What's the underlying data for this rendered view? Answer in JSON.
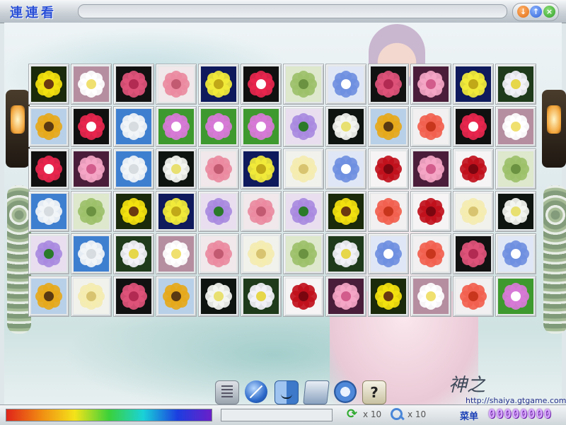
{
  "window": {
    "title": "連連看",
    "buttons": {
      "minimize": "↓",
      "maximize": "↑",
      "close": "×"
    }
  },
  "background": {
    "logo": "神之",
    "url": "http://shaiya.gtgame.com.cn"
  },
  "board": {
    "rows": 6,
    "cols": 12,
    "flower_types": {
      "yellow-daisy": {
        "bg": "#1a2a0a",
        "petal": "#f4e20f",
        "center": "#6b3a10"
      },
      "white-lily": {
        "bg": "#b58ea0",
        "petal": "#ffffff",
        "center": "#f0e070"
      },
      "pink-rose": {
        "bg": "#111111",
        "petal": "#e0537a",
        "center": "#b22a52"
      },
      "pink-gerbera": {
        "bg": "#f0e8ea",
        "petal": "#ea8aa0",
        "center": "#c25a72"
      },
      "yellow-aster": {
        "bg": "#0e1a5c",
        "petal": "#f3ec3a",
        "center": "#c0a818"
      },
      "red-carnation": {
        "bg": "#101010",
        "petal": "#e8264e",
        "center": "#ffffff"
      },
      "green-hydrangea": {
        "bg": "#dde8cc",
        "petal": "#9cc06a",
        "center": "#6a9240"
      },
      "blue-star": {
        "bg": "#dfe7f6",
        "petal": "#6f8fe0",
        "center": "#ffffff"
      },
      "pink-blossom": {
        "bg": "#4a1e3a",
        "petal": "#f5a6c6",
        "center": "#d25c8c"
      },
      "sunflower": {
        "bg": "#b8d0e8",
        "petal": "#e6a81a",
        "center": "#5a3a12"
      },
      "white-rose": {
        "bg": "#3e7fd0",
        "petal": "#f3f5f6",
        "center": "#d6dce0"
      },
      "pink-orchid": {
        "bg": "#3e9a2e",
        "petal": "#d87ad8",
        "center": "#ffffff"
      },
      "purple-iris": {
        "bg": "#e8def0",
        "petal": "#a88ae0",
        "center": "#2a7a2a"
      },
      "calla-lily": {
        "bg": "#0e1410",
        "petal": "#f4f6f2",
        "center": "#e8e070"
      },
      "coral-gerbera": {
        "bg": "#f2f0f0",
        "petal": "#f2604e",
        "center": "#c8361e"
      },
      "red-rose": {
        "bg": "#f6f4f4",
        "petal": "#c0101c",
        "center": "#7a0610"
      },
      "yellow-rose": {
        "bg": "#f2f2ec",
        "petal": "#f4ecb0",
        "center": "#d8c470"
      },
      "white-asters": {
        "bg": "#1e3a1a",
        "petal": "#f2f2f8",
        "center": "#e6d64a"
      }
    },
    "tiles": [
      [
        "yellow-daisy",
        "white-lily",
        "pink-rose",
        "pink-gerbera",
        "yellow-aster",
        "red-carnation",
        "green-hydrangea",
        "blue-star",
        "pink-rose",
        "pink-blossom",
        "yellow-aster",
        "white-asters"
      ],
      [
        "sunflower",
        "red-carnation",
        "white-rose",
        "pink-orchid",
        "pink-orchid",
        "pink-orchid",
        "purple-iris",
        "calla-lily",
        "sunflower",
        "coral-gerbera",
        "red-carnation",
        "white-lily"
      ],
      [
        "red-carnation",
        "pink-blossom",
        "white-rose",
        "calla-lily",
        "pink-gerbera",
        "yellow-aster",
        "yellow-rose",
        "blue-star",
        "red-rose",
        "pink-blossom",
        "red-rose",
        "green-hydrangea"
      ],
      [
        "white-rose",
        "green-hydrangea",
        "yellow-daisy",
        "yellow-aster",
        "purple-iris",
        "pink-gerbera",
        "purple-iris",
        "yellow-daisy",
        "coral-gerbera",
        "red-rose",
        "yellow-rose",
        "calla-lily"
      ],
      [
        "purple-iris",
        "white-rose",
        "white-asters",
        "white-lily",
        "pink-gerbera",
        "yellow-rose",
        "green-hydrangea",
        "white-asters",
        "blue-star",
        "coral-gerbera",
        "pink-rose",
        "blue-star"
      ],
      [
        "sunflower",
        "yellow-rose",
        "pink-rose",
        "sunflower",
        "calla-lily",
        "white-asters",
        "red-rose",
        "pink-blossom",
        "yellow-daisy",
        "white-lily",
        "coral-gerbera",
        "pink-orchid"
      ]
    ]
  },
  "dock": {
    "icons": [
      "calculator-icon",
      "safari-icon",
      "finder-icon",
      "drive-icon",
      "settings-icon",
      "help-icon"
    ],
    "help_glyph": "?"
  },
  "status": {
    "time_remaining": 1.0,
    "refresh_glyph": "⟳",
    "refresh_count": "x 10",
    "hint_count": "x 10",
    "menu_label": "菜单",
    "score": "00000000"
  }
}
